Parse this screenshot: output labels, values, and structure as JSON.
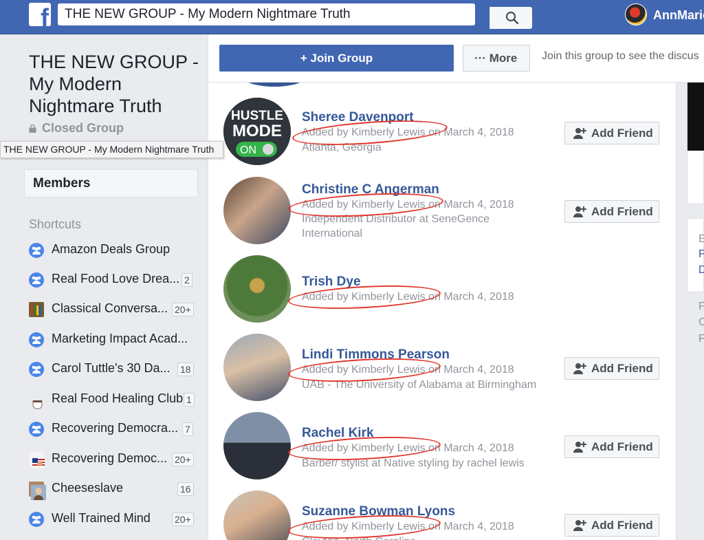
{
  "header": {
    "search_value": "THE NEW GROUP - My Modern Nightmare Truth",
    "user_name": "AnnMarie"
  },
  "group": {
    "title": "THE NEW GROUP - My Modern Nightmare Truth",
    "privacy": "Closed Group",
    "tooltip": "THE NEW GROUP - My Modern Nightmare Truth",
    "members_tab": "Members"
  },
  "shortcuts": {
    "header": "Shortcuts",
    "items": [
      {
        "label": "Amazon Deals Group",
        "badge": "",
        "icon": "group-icon"
      },
      {
        "label": "Real Food Love Drea...",
        "badge": "2",
        "icon": "group-icon"
      },
      {
        "label": "Classical Conversa...",
        "badge": "20+",
        "icon": "bookshelf-icon"
      },
      {
        "label": "Marketing Impact Acad...",
        "badge": "",
        "icon": "group-icon"
      },
      {
        "label": "Carol Tuttle's 30 Da...",
        "badge": "18",
        "icon": "group-icon"
      },
      {
        "label": "Real Food Healing Club",
        "badge": "1",
        "icon": "coffee-cup-icon"
      },
      {
        "label": "Recovering Democra...",
        "badge": "7",
        "icon": "group-icon"
      },
      {
        "label": "Recovering Democ...",
        "badge": "20+",
        "icon": "flag-icon"
      },
      {
        "label": "Cheeseslave",
        "badge": "16",
        "icon": "photo-icon"
      },
      {
        "label": "Well Trained Mind",
        "badge": "20+",
        "icon": "group-icon"
      }
    ]
  },
  "actions": {
    "join_label": "Join Group",
    "more_label": "More",
    "join_message": "Join this group to see the discus"
  },
  "members": [
    {
      "name": "Sheree Davenport",
      "added_prefix": "Added by",
      "added_by": "Kimberly Lewis",
      "added_suffix": "on March 4, 2018",
      "detail1": "Atlanta, Georgia",
      "detail2": "",
      "avatar_text": "HUSTLE MODE",
      "toggle_text": "ON"
    },
    {
      "name": "Christine C Angerman",
      "added_prefix": "Added by",
      "added_by": "Kimberly Lewis",
      "added_suffix": "on March 4, 2018",
      "detail1": "Independent Distributor at SeneGence",
      "detail2": "International"
    },
    {
      "name": "Trish Dye",
      "added_prefix": "Added by",
      "added_by": "Kimberly Lewis",
      "added_suffix": "on March 4, 2018",
      "detail1": "",
      "detail2": ""
    },
    {
      "name": "Lindi Timmons Pearson",
      "added_prefix": "Added by",
      "added_by": "Kimberly Lewis",
      "added_suffix": "on March 4, 2018",
      "detail1": "UAB - The University of Alabama at Birmingham",
      "detail2": ""
    },
    {
      "name": "Rachel Kirk",
      "added_prefix": "Added by",
      "added_by": "Kimberly Lewis",
      "added_suffix": "on March 4, 2018",
      "detail1": "Barber/ stylist at Native styling by rachel lewis",
      "detail2": ""
    },
    {
      "name": "Suzanne Bowman Lyons",
      "added_prefix": "Added by",
      "added_by": "Kimberly Lewis",
      "added_suffix": "on March 4, 2018",
      "detail1": "Clayton, North Carolina",
      "detail2": ""
    }
  ],
  "add_friend_label": "Add Friend",
  "right_col": {
    "letters": [
      "E",
      "P",
      "D",
      "P",
      "C",
      "F"
    ]
  },
  "colors": {
    "brand": "#4267b2",
    "link": "#365899",
    "annotation": "#e0352b"
  }
}
